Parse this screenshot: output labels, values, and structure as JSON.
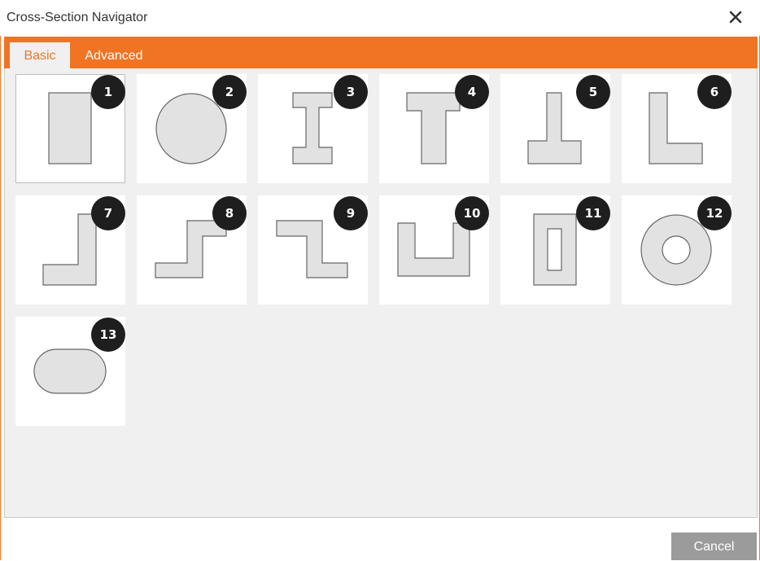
{
  "window": {
    "title": "Cross-Section Navigator",
    "accent_color": "#f07424",
    "close_icon": "close-icon"
  },
  "tabs": [
    {
      "label": "Basic",
      "active": true
    },
    {
      "label": "Advanced",
      "active": false
    }
  ],
  "sections": [
    {
      "number": "1",
      "shape": "rectangle-icon",
      "selected": true
    },
    {
      "number": "2",
      "shape": "circle-icon",
      "selected": false
    },
    {
      "number": "3",
      "shape": "i-beam-icon",
      "selected": false
    },
    {
      "number": "4",
      "shape": "t-section-icon",
      "selected": false
    },
    {
      "number": "5",
      "shape": "inverted-t-section-icon",
      "selected": false
    },
    {
      "number": "6",
      "shape": "l-angle-icon",
      "selected": false
    },
    {
      "number": "7",
      "shape": "mirrored-l-angle-icon",
      "selected": false
    },
    {
      "number": "8",
      "shape": "z-section-icon",
      "selected": false
    },
    {
      "number": "9",
      "shape": "mirrored-z-section-icon",
      "selected": false
    },
    {
      "number": "10",
      "shape": "u-channel-icon",
      "selected": false
    },
    {
      "number": "11",
      "shape": "hollow-rectangle-icon",
      "selected": false
    },
    {
      "number": "12",
      "shape": "hollow-circle-icon",
      "selected": false
    },
    {
      "number": "13",
      "shape": "rounded-rectangle-icon",
      "selected": false
    }
  ],
  "footer": {
    "cancel_label": "Cancel"
  }
}
